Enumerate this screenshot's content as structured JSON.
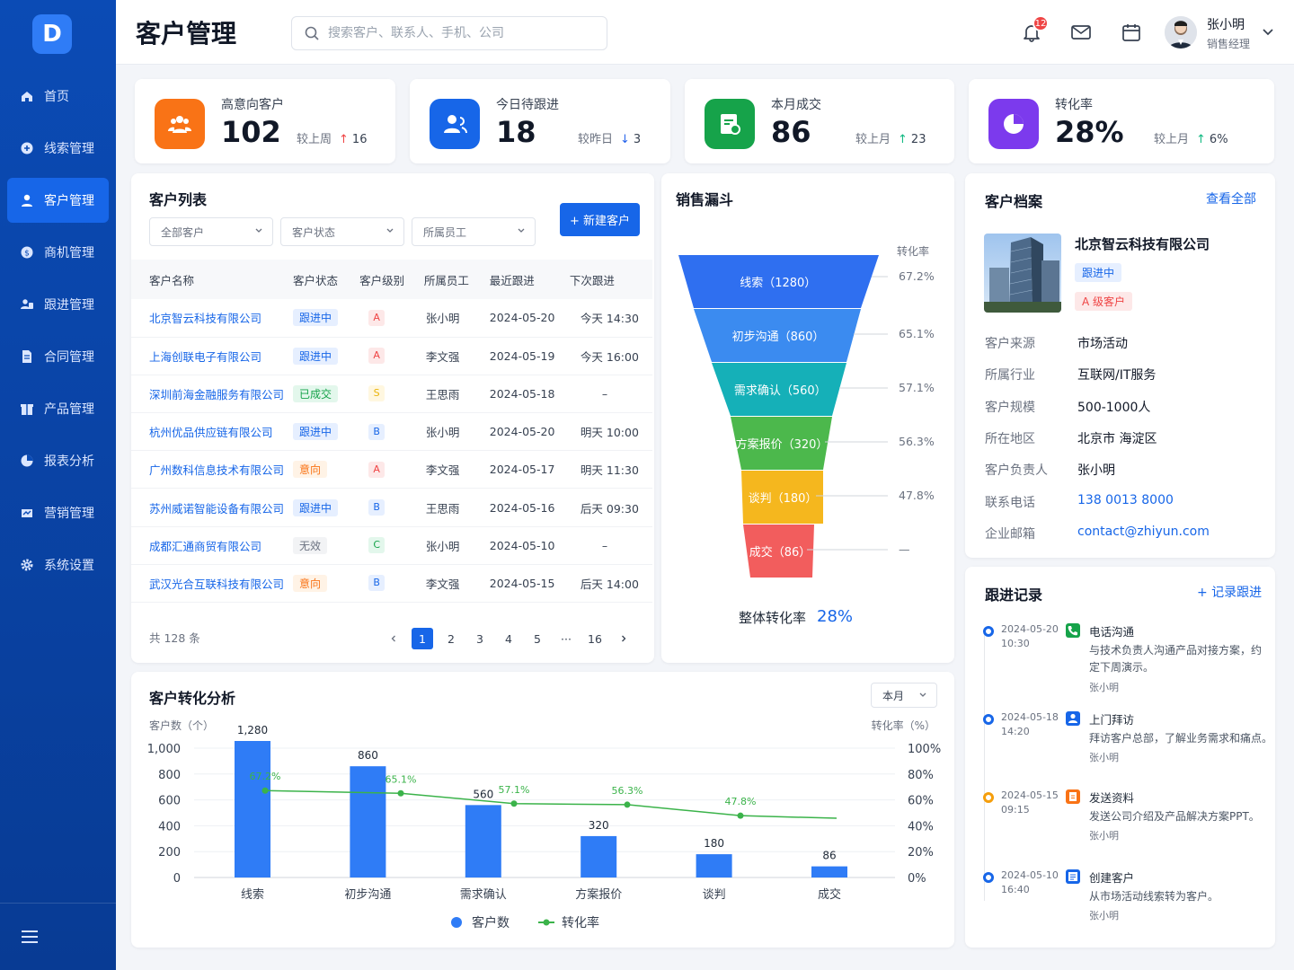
{
  "brand": {
    "logo_letter": "D",
    "accent": "#1766e8"
  },
  "nav": [
    {
      "label": "首页",
      "icon": "home-icon"
    },
    {
      "label": "线索管理",
      "icon": "lead-icon"
    },
    {
      "label": "客户管理",
      "icon": "user-icon",
      "active": true
    },
    {
      "label": "商机管理",
      "icon": "opportunity-icon"
    },
    {
      "label": "跟进管理",
      "icon": "followup-icon"
    },
    {
      "label": "合同管理",
      "icon": "contract-icon"
    },
    {
      "label": "产品管理",
      "icon": "product-icon"
    },
    {
      "label": "报表分析",
      "icon": "report-icon"
    },
    {
      "label": "营销管理",
      "icon": "marketing-icon"
    },
    {
      "label": "系统设置",
      "icon": "gear-icon"
    }
  ],
  "header": {
    "title": "客户管理",
    "search_placeholder": "搜索客户、联系人、手机、公司",
    "notify_count": "12",
    "user_name": "张小明",
    "user_role": "销售经理"
  },
  "stats": [
    {
      "label": "高意向客户",
      "value": "102",
      "trend_label": "较上周",
      "arrow": "↑",
      "trend": "16",
      "color": "#f97316"
    },
    {
      "label": "今日待跟进",
      "value": "18",
      "trend_label": "较昨日",
      "arrow": "↓",
      "trend": "3",
      "color": "#1766e8"
    },
    {
      "label": "本月成交",
      "value": "86",
      "trend_label": "较上月",
      "arrow": "↑",
      "trend": "23",
      "color": "#16a34a"
    },
    {
      "label": "转化率",
      "value": "28%",
      "trend_label": "较上月",
      "arrow": "↑",
      "trend": "6%",
      "color": "#7c3aed"
    }
  ],
  "customer_list": {
    "title": "客户列表",
    "filters": [
      "全部客户",
      "客户状态",
      "所属员工"
    ],
    "new_button": "+ 新建客户",
    "columns": [
      "客户名称",
      "客户状态",
      "客户级别",
      "所属员工",
      "最近跟进",
      "下次跟进"
    ],
    "rows": [
      {
        "name": "北京智云科技有限公司",
        "status": "跟进中",
        "st": "blue",
        "level": "A",
        "owner": "张小明",
        "last": "2024-05-20",
        "next": "今天 14:30"
      },
      {
        "name": "上海创联电子有限公司",
        "status": "跟进中",
        "st": "blue",
        "level": "A",
        "owner": "李文强",
        "last": "2024-05-19",
        "next": "今天 16:00"
      },
      {
        "name": "深圳前海金融服务有限公司",
        "status": "已成交",
        "st": "green",
        "level": "S",
        "owner": "王思雨",
        "last": "2024-05-18",
        "next": "–"
      },
      {
        "name": "杭州优品供应链有限公司",
        "status": "跟进中",
        "st": "blue",
        "level": "B",
        "owner": "张小明",
        "last": "2024-05-20",
        "next": "明天 10:00"
      },
      {
        "name": "广州数科信息技术有限公司",
        "status": "意向",
        "st": "orange",
        "level": "A",
        "owner": "李文强",
        "last": "2024-05-17",
        "next": "明天 11:30"
      },
      {
        "name": "苏州威诺智能设备有限公司",
        "status": "跟进中",
        "st": "blue",
        "level": "B",
        "owner": "王思雨",
        "last": "2024-05-16",
        "next": "后天 09:30"
      },
      {
        "name": "成都汇通商贸有限公司",
        "status": "无效",
        "st": "gray",
        "level": "C",
        "owner": "张小明",
        "last": "2024-05-10",
        "next": "–"
      },
      {
        "name": "武汉光合互联科技有限公司",
        "status": "意向",
        "st": "orange",
        "level": "B",
        "owner": "李文强",
        "last": "2024-05-15",
        "next": "后天 14:00"
      }
    ],
    "total": "共 128 条",
    "pages": [
      "1",
      "2",
      "3",
      "4",
      "5",
      "···",
      "16"
    ],
    "current_page": "1"
  },
  "funnel": {
    "title": "销售漏斗",
    "rate_header": "转化率",
    "stages": [
      {
        "label": "线索（1280）",
        "rate": "67.2%",
        "color": "#2f6ff0"
      },
      {
        "label": "初步沟通（860）",
        "rate": "65.1%",
        "color": "#3b8bf0"
      },
      {
        "label": "需求确认（560）",
        "rate": "57.1%",
        "color": "#15b0b8"
      },
      {
        "label": "方案报价（320）",
        "rate": "56.3%",
        "color": "#4cb84c"
      },
      {
        "label": "谈判（180）",
        "rate": "47.8%",
        "color": "#f5b71e"
      },
      {
        "label": "成交（86）",
        "rate": "—",
        "color": "#f25d5d"
      }
    ],
    "overall_label": "整体转化率",
    "overall_value": "28%"
  },
  "profile": {
    "title": "客户档案",
    "view_all": "查看全部",
    "company": "北京智云科技有限公司",
    "tag_status": "跟进中",
    "tag_level": "A 级客户",
    "fields": [
      {
        "k": "客户来源",
        "v": "市场活动"
      },
      {
        "k": "所属行业",
        "v": "互联网/IT服务"
      },
      {
        "k": "客户规模",
        "v": "500-1000人"
      },
      {
        "k": "所在地区",
        "v": "北京市 海淀区"
      },
      {
        "k": "客户负责人",
        "v": "张小明"
      },
      {
        "k": "联系电话",
        "v": "138 0013 8000",
        "link": true
      },
      {
        "k": "企业邮箱",
        "v": "contact@zhiyun.com",
        "link": true
      }
    ]
  },
  "followups": {
    "title": "跟进记录",
    "add": "+ 记录跟进",
    "items": [
      {
        "date": "2024-05-20",
        "time": "10:30",
        "type": "电话沟通",
        "icon": "phone-icon",
        "color": "#16a34a",
        "dot": "#1766e8",
        "desc": "与技术负责人沟通产品对接方案，约定下周演示。",
        "who": "张小明"
      },
      {
        "date": "2024-05-18",
        "time": "14:20",
        "type": "上门拜访",
        "icon": "visit-icon",
        "color": "#1766e8",
        "dot": "#1766e8",
        "desc": "拜访客户总部，了解业务需求和痛点。",
        "who": "张小明"
      },
      {
        "date": "2024-05-15",
        "time": "09:15",
        "type": "发送资料",
        "icon": "document-icon",
        "color": "#f97316",
        "dot": "#f59e0b",
        "desc": "发送公司介绍及产品解决方案PPT。",
        "who": "张小明"
      },
      {
        "date": "2024-05-10",
        "time": "16:40",
        "type": "创建客户",
        "icon": "create-icon",
        "color": "#1766e8",
        "dot": "#1766e8",
        "desc": "从市场活动线索转为客户。",
        "who": "张小明"
      }
    ]
  },
  "conversion": {
    "title": "客户转化分析",
    "period": "本月"
  },
  "chart_data": {
    "type": "bar",
    "title": "客户转化分析",
    "ylabel": "客户数（个）",
    "y2label": "转化率（%）",
    "categories": [
      "线索",
      "初步沟通",
      "需求确认",
      "方案报价",
      "谈判",
      "成交"
    ],
    "ylim": [
      0,
      1000
    ],
    "y2lim": [
      0,
      100
    ],
    "yticks": [
      "1,000",
      "800",
      "600",
      "400",
      "200",
      "0"
    ],
    "y2ticks": [
      "100%",
      "80%",
      "60%",
      "40%",
      "20%",
      "0%"
    ],
    "series": [
      {
        "name": "客户数",
        "type": "bar",
        "values": [
          1280,
          860,
          560,
          320,
          180,
          86
        ],
        "labels": [
          "1,280",
          "860",
          "560",
          "320",
          "180",
          "86"
        ],
        "color": "#2f7cf6"
      },
      {
        "name": "转化率",
        "type": "line",
        "values": [
          67.2,
          65.1,
          57.1,
          56.3,
          47.8
        ],
        "labels": [
          "67.2%",
          "65.1%",
          "57.1%",
          "56.3%",
          "47.8%"
        ],
        "end_value": 45.8,
        "color": "#3bb34a"
      }
    ],
    "legend": "bottom"
  }
}
